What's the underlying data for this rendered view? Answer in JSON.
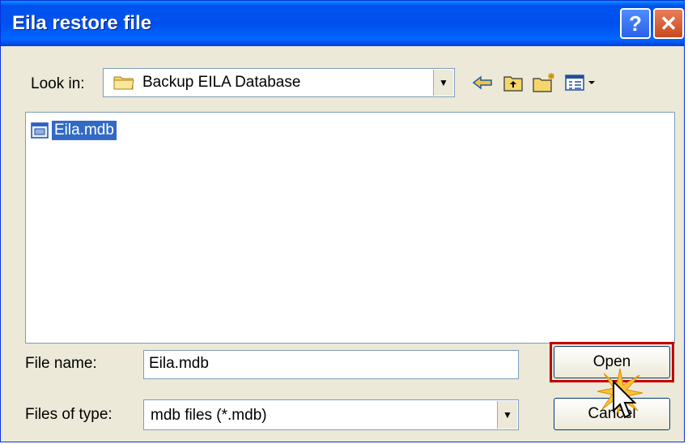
{
  "window": {
    "title": "Eila restore file"
  },
  "titlebar": {
    "help_label": "?",
    "close_label": "✕"
  },
  "lookin": {
    "label": "Look in:",
    "value": "Backup EILA Database"
  },
  "toolbar": {
    "back_icon": "back-arrow-icon",
    "up_icon": "up-folder-icon",
    "new_icon": "new-folder-icon",
    "view_icon": "view-menu-icon"
  },
  "files": [
    {
      "name": "Eila.mdb",
      "selected": true
    }
  ],
  "filename": {
    "label": "File name:",
    "value": "Eila.mdb"
  },
  "filetype": {
    "label": "Files of type:",
    "value": "mdb files (*.mdb)"
  },
  "buttons": {
    "open": "Open",
    "cancel": "Cancel"
  },
  "colors": {
    "titlebar": "#0054e3",
    "selection": "#316ac5",
    "highlight_border": "#c00000"
  }
}
